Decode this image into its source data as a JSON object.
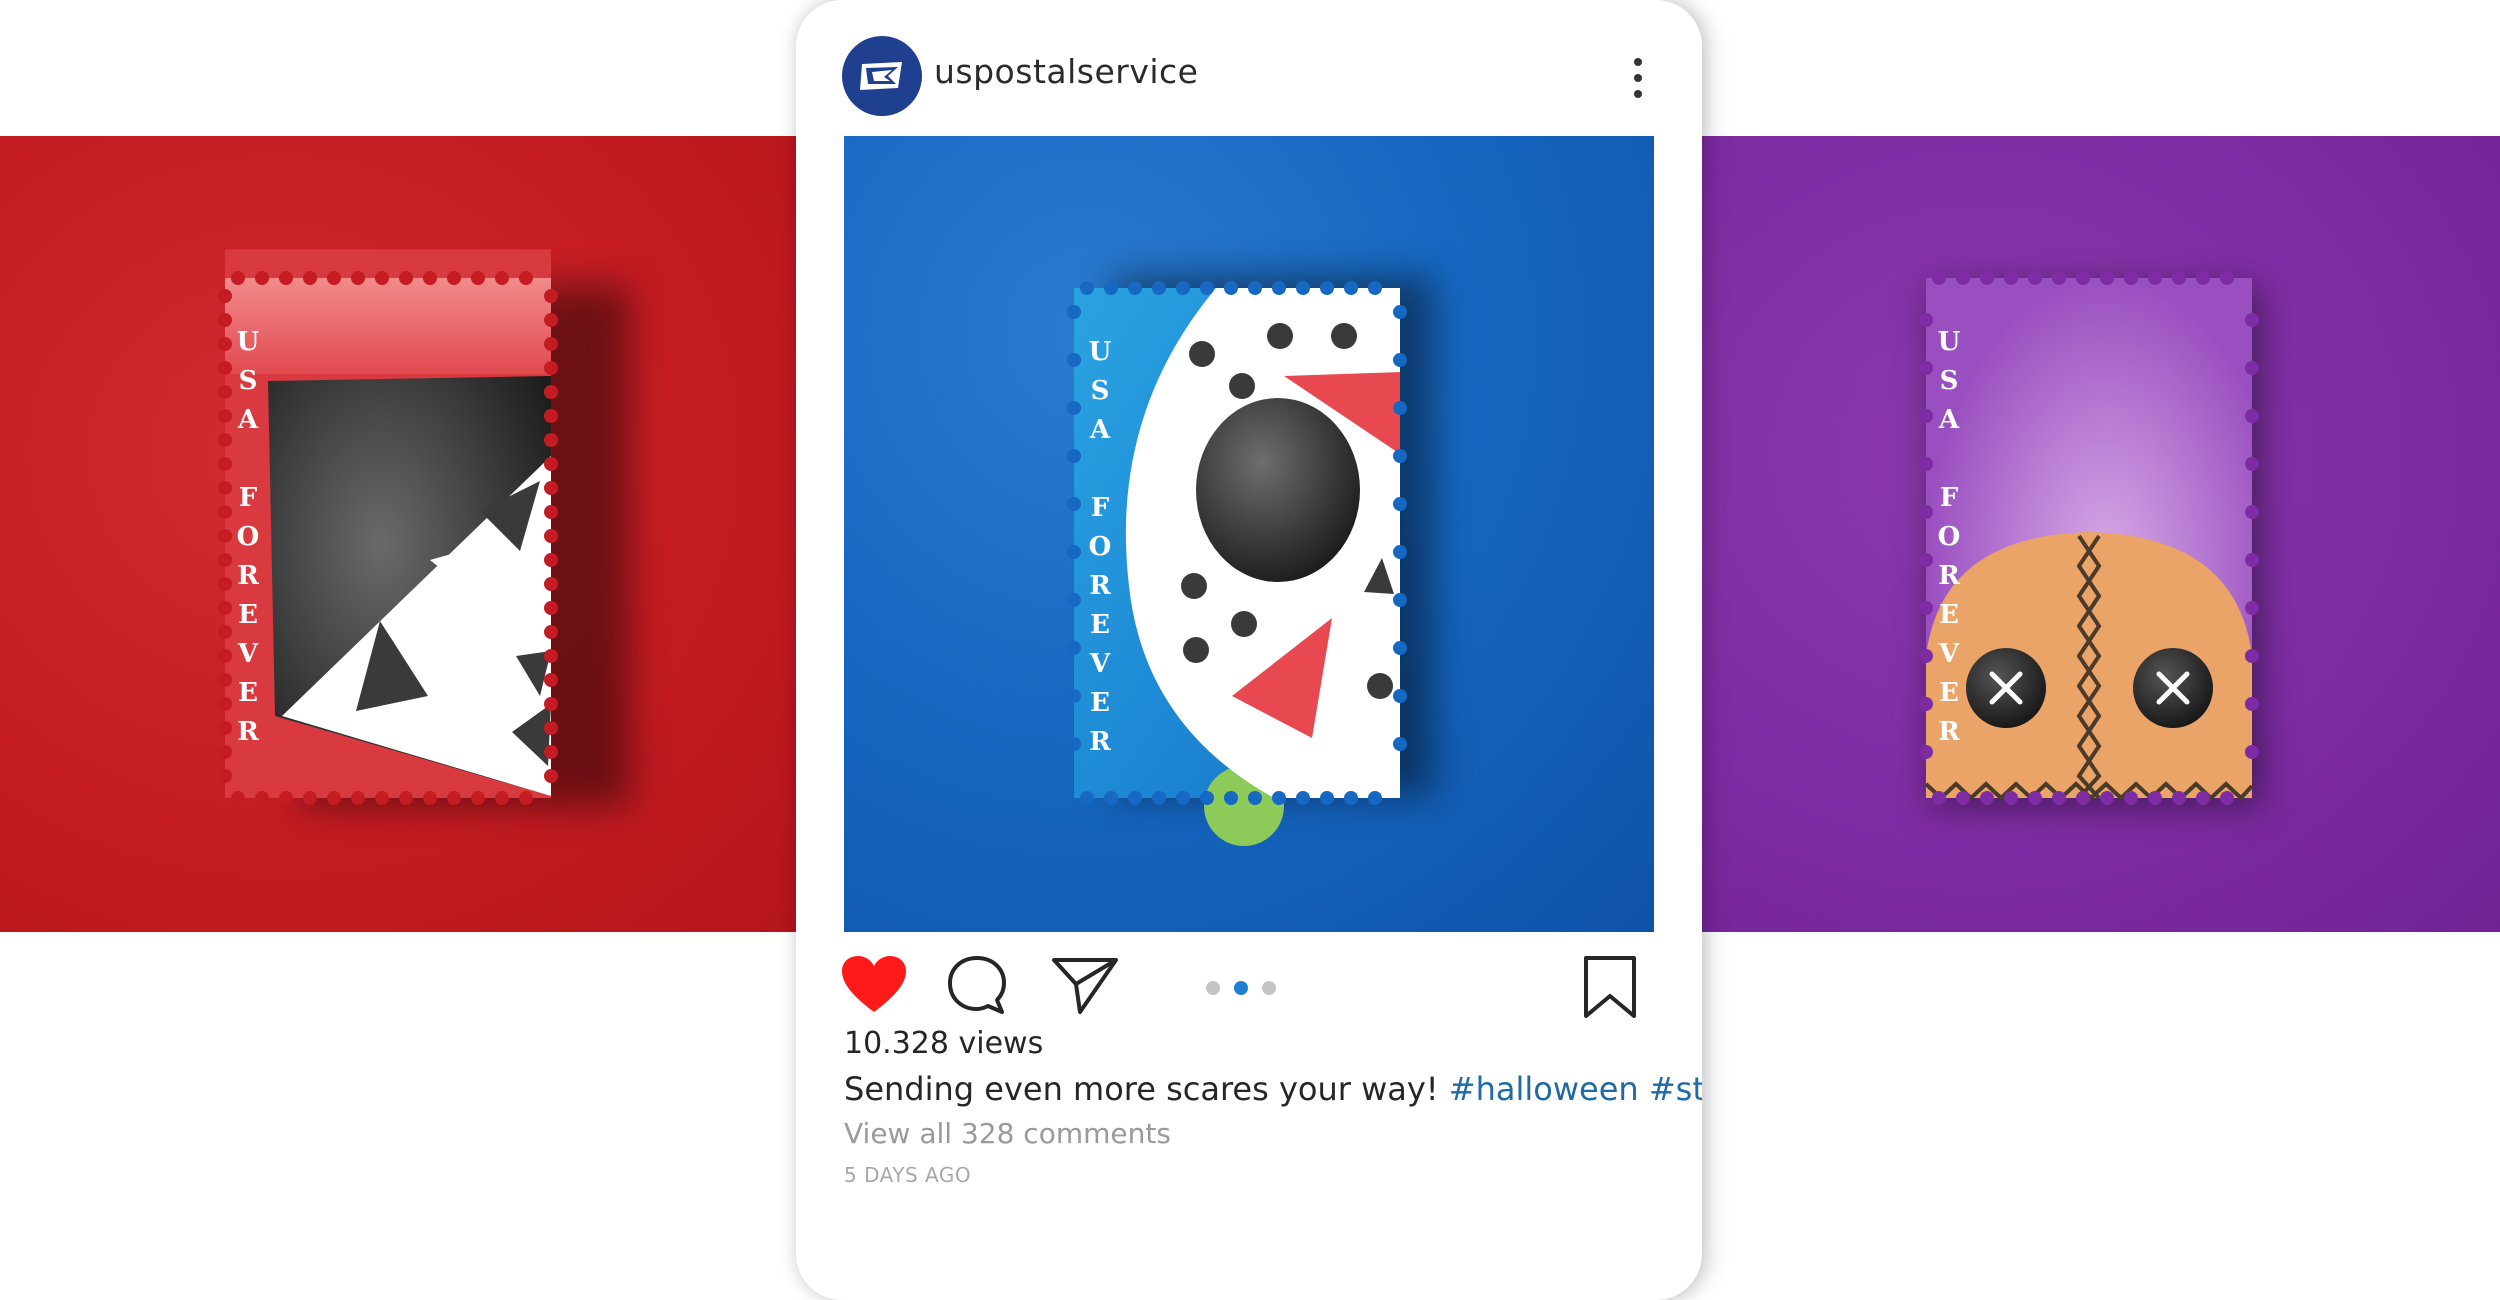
{
  "post": {
    "username": "uspostalservice",
    "views_text": "10.328 views",
    "caption_text": "Sending even more scares your way! ",
    "hashtags": [
      "#halloween",
      "#stamps"
    ],
    "comments_text": "View all 328 comments",
    "time_text": "5 DAYS AGO",
    "carousel": {
      "total": 3,
      "active_index": 2
    },
    "liked": true
  },
  "stamps": {
    "label": "USA FOREVER",
    "letters": [
      "U",
      "S",
      "A",
      "",
      "F",
      "O",
      "R",
      "E",
      "V",
      "E",
      "R"
    ]
  },
  "icons": {
    "avatar": "usps-eagle-logo",
    "more": "vertical-ellipsis-icon",
    "like": "heart-icon",
    "comment": "speech-bubble-icon",
    "share": "paper-plane-icon",
    "save": "bookmark-icon"
  },
  "colors": {
    "left_panel": "#c41c22",
    "center_image": "#1668c2",
    "right_panel": "#7e2ca3",
    "like_red": "#ff1a1a",
    "hashtag_blue": "#1f6aa5",
    "active_dot": "#1d7fd0"
  }
}
